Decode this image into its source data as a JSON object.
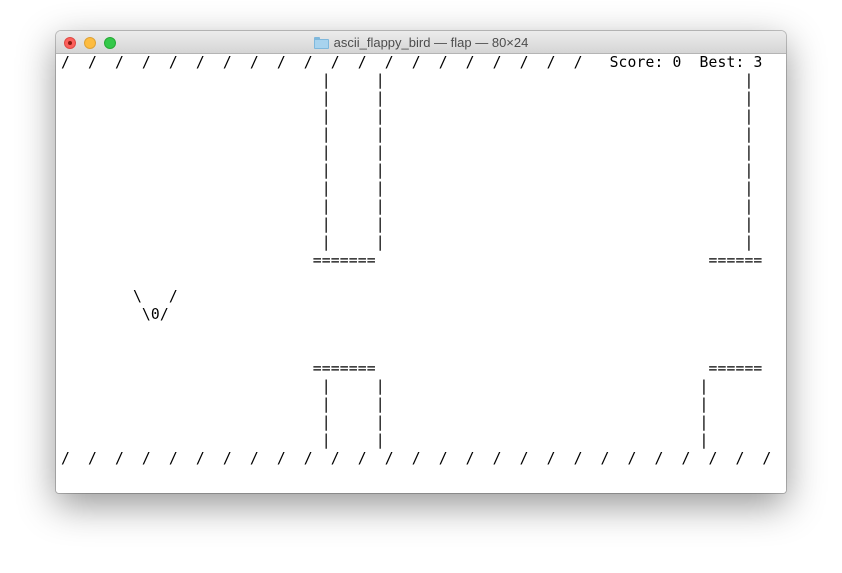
{
  "window": {
    "title": "ascii_flappy_bird — flap — 80×24",
    "folder_icon": "folder-icon"
  },
  "colors": {
    "close": "#fc605c",
    "minimize": "#fdbc40",
    "zoom": "#34c84a",
    "terminal_bg": "#ffffff",
    "terminal_fg": "#000000"
  },
  "game": {
    "score_label": "Score:",
    "score_value": "0",
    "best_label": "Best:",
    "best_value": "3",
    "screen": {
      "top_border": "/  /  /  /  /  /  /  /  /  /  /  /  /  /  /  /  /  /  /  /",
      "rows": [
        "                             |     |                                        |",
        "                             |     |                                        |",
        "                             |     |                                        |",
        "                             |     |                                        |",
        "                             |     |                                        |",
        "                             |     |                                        |",
        "                             |     |                                        |",
        "                             |     |                                        |",
        "                             |     |                                        |",
        "                             |     |                                        |",
        "                            =======                                     ======",
        "",
        "        \\   /",
        "         \\0/",
        "",
        "",
        "                            =======                                     ======",
        "                             |     |                                   |",
        "                             |     |                                   |",
        "                             |     |                                   |",
        "                             |     |                                   |"
      ],
      "bottom_border": "/  /  /  /  /  /  /  /  /  /  /  /  /  /  /  /  /  /  /  /  /  /  /  /  /  /  /"
    }
  }
}
